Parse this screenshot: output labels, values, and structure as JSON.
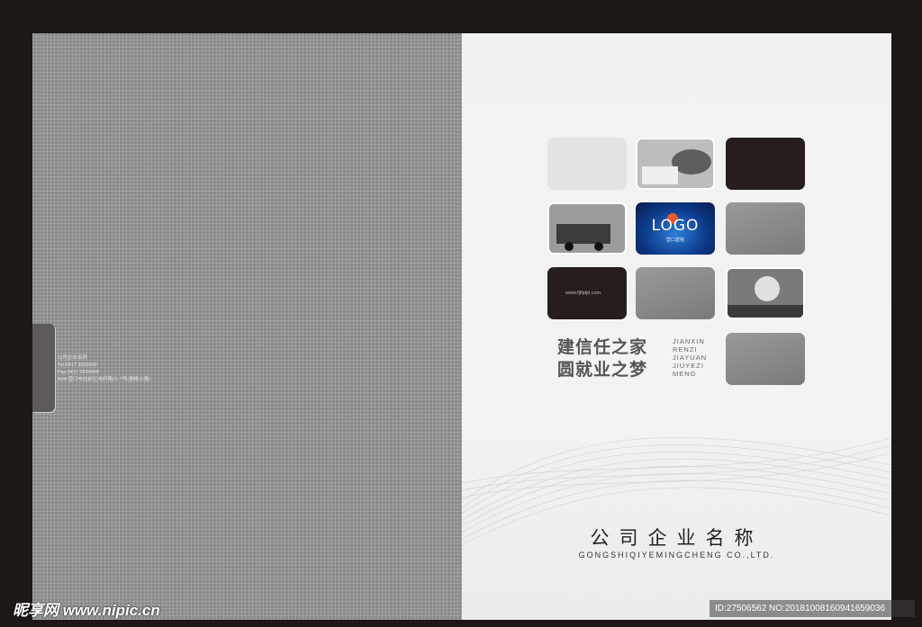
{
  "back_cover": {
    "contact_lines": [
      "公司企业名称",
      "Tel:0417 2820000",
      "Fax:0417 2834999",
      "Add:营口市站前区市府路21-7号(泰格公寓)"
    ]
  },
  "front_cover": {
    "url": "www.fjfljdjd.com",
    "logo": {
      "text": "LOGO",
      "subtext": "营口建铭"
    },
    "slogan": {
      "line1": "建信任之家",
      "line2": "圆就业之梦"
    },
    "pinyin": [
      "JIANXIN",
      "RENZI",
      "JIAYUAN",
      "JIUYEZI",
      "MENG"
    ],
    "company_name": "公司企业名称",
    "company_name_en": "GONGSHIQIYEMINGCHENG CO.,LTD."
  },
  "watermark": {
    "left": "昵享网 www.nipic.cn",
    "right": "ID:27506562 NO:20181008160941659036"
  },
  "colors": {
    "frame": "#1d1716",
    "back_cover": "#8a8a8a",
    "front_cover": "#f1f1f1",
    "dark_tile": "#261e1c",
    "logo_blue": "#0e3b8c"
  }
}
